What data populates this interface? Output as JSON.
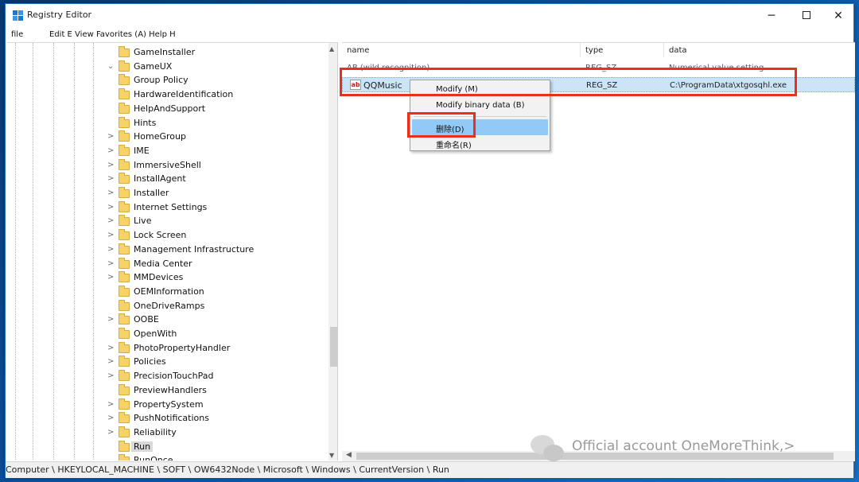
{
  "window": {
    "title": "Registry Editor",
    "controls": {
      "minimize": "─",
      "close": "✕"
    }
  },
  "menubar": {
    "file": "file",
    "rest": "Edit E View Favorites (A) Help H"
  },
  "tree": {
    "items": [
      {
        "label": "GameInstaller",
        "expand": ""
      },
      {
        "label": "GameUX",
        "expand": "⌄"
      },
      {
        "label": "Group Policy",
        "expand": ""
      },
      {
        "label": "HardwareIdentification",
        "expand": ""
      },
      {
        "label": "HelpAndSupport",
        "expand": ""
      },
      {
        "label": "Hints",
        "expand": ""
      },
      {
        "label": "HomeGroup",
        "expand": ">"
      },
      {
        "label": "IME",
        "expand": ">"
      },
      {
        "label": "ImmersiveShell",
        "expand": ">"
      },
      {
        "label": "InstallAgent",
        "expand": ">"
      },
      {
        "label": "Installer",
        "expand": ">"
      },
      {
        "label": "Internet Settings",
        "expand": ">"
      },
      {
        "label": "Live",
        "expand": ">"
      },
      {
        "label": "Lock Screen",
        "expand": ">"
      },
      {
        "label": "Management Infrastructure",
        "expand": ">"
      },
      {
        "label": "Media Center",
        "expand": ">"
      },
      {
        "label": "MMDevices",
        "expand": ">"
      },
      {
        "label": "OEMInformation",
        "expand": ""
      },
      {
        "label": "OneDriveRamps",
        "expand": ""
      },
      {
        "label": "OOBE",
        "expand": ">"
      },
      {
        "label": "OpenWith",
        "expand": ""
      },
      {
        "label": "PhotoPropertyHandler",
        "expand": ">"
      },
      {
        "label": "Policies",
        "expand": ">"
      },
      {
        "label": "PrecisionTouchPad",
        "expand": ">"
      },
      {
        "label": "PreviewHandlers",
        "expand": ""
      },
      {
        "label": "PropertySystem",
        "expand": ">"
      },
      {
        "label": "PushNotifications",
        "expand": ">"
      },
      {
        "label": "Reliability",
        "expand": ">"
      },
      {
        "label": "Run",
        "expand": ""
      },
      {
        "label": "RunOnce",
        "expand": ""
      }
    ]
  },
  "list": {
    "headers": {
      "name": "name",
      "type": "type",
      "data": "data"
    },
    "rows": [
      {
        "name": "AB (wild recognition)",
        "type": "REG_SZ",
        "data": "Numerical value setting"
      },
      {
        "icon": "ab",
        "name": "QQMusic",
        "type": "REG_SZ",
        "data": "C:\\ProgramData\\xtgosqhl.exe"
      }
    ]
  },
  "context_menu": {
    "items": [
      {
        "label": "Modify (M)"
      },
      {
        "label": "Modify binary data (B)"
      },
      {
        "label": "删除(D)"
      },
      {
        "label": "重命名(R)"
      }
    ]
  },
  "statusbar": {
    "path": "Computer \\ HKEYLOCAL_MACHINE \\ SOFT \\ OW6432Node \\ Microsoft \\ Windows \\ CurrentVersion \\ Run"
  },
  "watermark": {
    "text": "Official account OneMoreThink,>"
  },
  "colors": {
    "accent": "#1b78d0",
    "selection": "#cce4f7",
    "menu_highlight": "#91c9f7",
    "annotation_red": "#e8301c"
  }
}
